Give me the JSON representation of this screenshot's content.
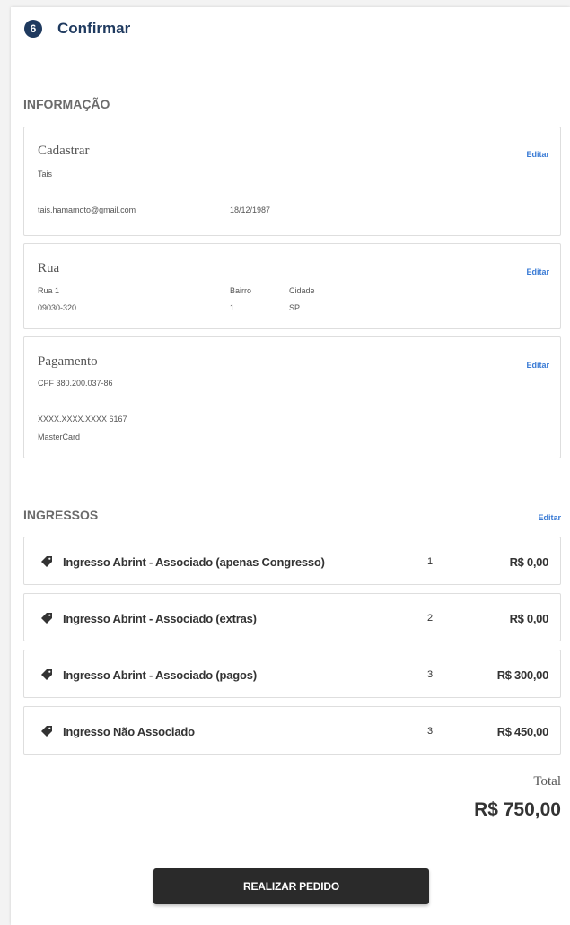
{
  "header": {
    "step_number": "6",
    "title": "Confirmar"
  },
  "info": {
    "section_title": "INFORMAÇÃO",
    "cadastro": {
      "title": "Cadastrar",
      "edit_label": "Editar",
      "name": "Tais",
      "email": "tais.hamamoto@gmail.com",
      "birthdate": "18/12/1987"
    },
    "rua": {
      "title": "Rua",
      "edit_label": "Editar",
      "street": "Rua 1",
      "zip": "09030-320",
      "bairro_label": "Bairro",
      "bairro_value": "1",
      "cidade_label": "Cidade",
      "cidade_value": "SP"
    },
    "pagamento": {
      "title": "Pagamento",
      "edit_label": "Editar",
      "cpf": "CPF 380.200.037-86",
      "card_number": "XXXX.XXXX.XXXX 6167",
      "card_brand": "MasterCard"
    }
  },
  "tickets": {
    "section_title": "INGRESSOS",
    "edit_label": "Editar",
    "icon": "tag-icon",
    "items": [
      {
        "name": "Ingresso Abrint - Associado (apenas Congresso)",
        "qty": "1",
        "price": "R$ 0,00"
      },
      {
        "name": "Ingresso Abrint - Associado (extras)",
        "qty": "2",
        "price": "R$ 0,00"
      },
      {
        "name": "Ingresso Abrint - Associado (pagos)",
        "qty": "3",
        "price": "R$ 300,00"
      },
      {
        "name": "Ingresso Não Associado",
        "qty": "3",
        "price": "R$ 450,00"
      }
    ]
  },
  "total": {
    "label": "Total",
    "value": "R$ 750,00"
  },
  "actions": {
    "order_button": "REALIZAR PEDIDO"
  },
  "colors": {
    "step_badge": "#1f3a5f",
    "link": "#3a7bd5",
    "button": "#2a2a2a"
  }
}
